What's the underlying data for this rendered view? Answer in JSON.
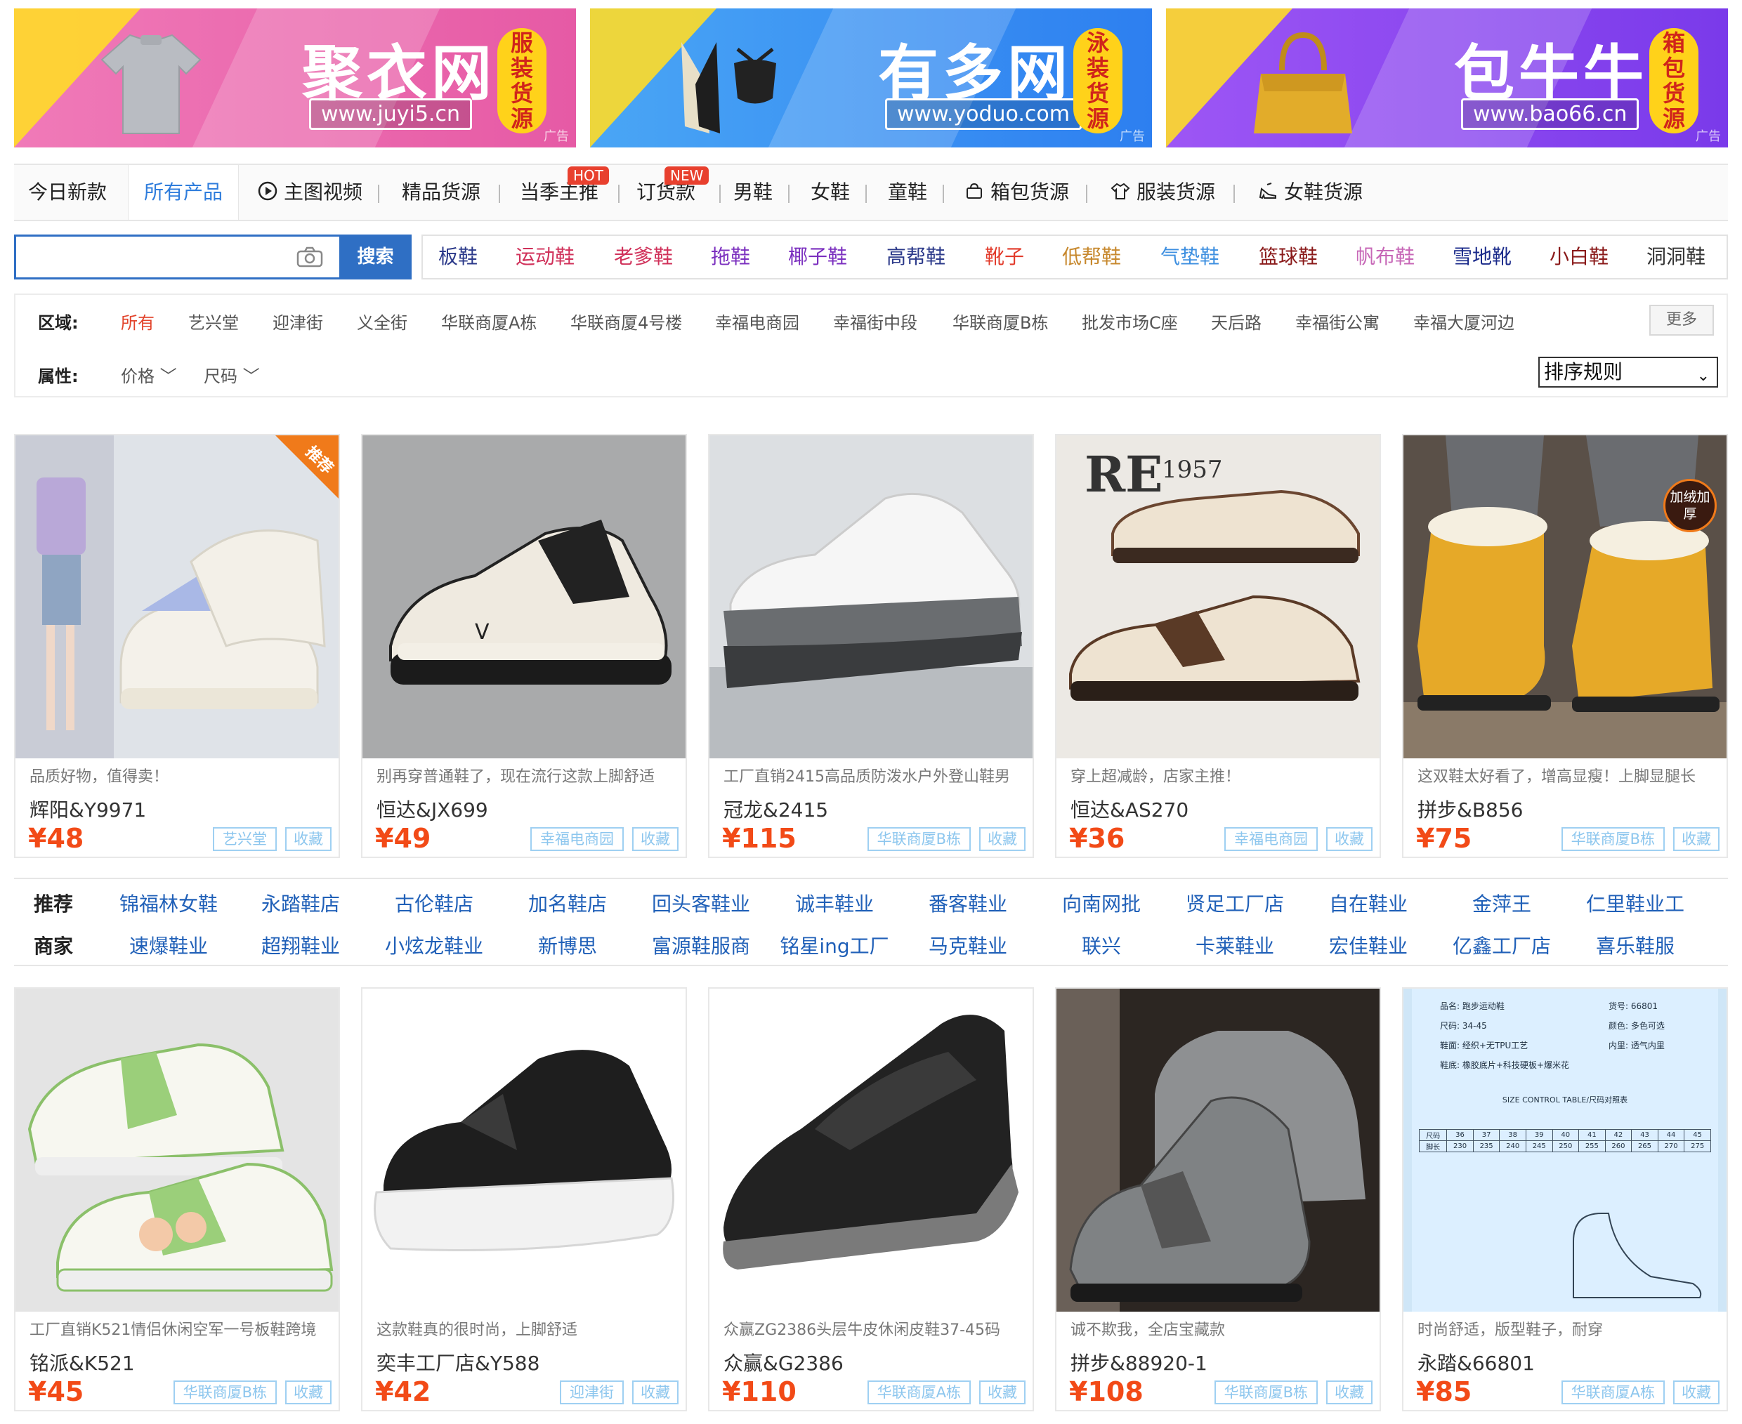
{
  "banners": [
    {
      "name": "聚衣网",
      "url": "www.juyi5.cn",
      "tag": [
        "服",
        "装",
        "货",
        "源"
      ],
      "ad": "广告",
      "color": "#ea5fa8"
    },
    {
      "name": "有多网",
      "url": "www.yoduo.com",
      "tag": [
        "泳",
        "装",
        "货",
        "源"
      ],
      "ad": "广告",
      "color": "#2f8ff0"
    },
    {
      "name": "包牛牛",
      "url": "www.bao66.cn",
      "tag": [
        "箱",
        "包",
        "货",
        "源"
      ],
      "ad": "广告",
      "color": "#8d4af0"
    }
  ],
  "nav": {
    "items": [
      "今日新款",
      "所有产品",
      "主图视频",
      "精品货源",
      "当季主推",
      "订货款",
      "男鞋",
      "女鞋",
      "童鞋",
      "箱包货源",
      "服装货源",
      "女鞋货源"
    ],
    "badges": {
      "hot": "HOT",
      "new": "NEW"
    }
  },
  "search": {
    "placeholder": "",
    "button": "搜索"
  },
  "categories": [
    {
      "label": "板鞋",
      "color": "#2c3a8a"
    },
    {
      "label": "运动鞋",
      "color": "#d0315a"
    },
    {
      "label": "老爹鞋",
      "color": "#d0315a"
    },
    {
      "label": "拖鞋",
      "color": "#7b2fbf"
    },
    {
      "label": "椰子鞋",
      "color": "#7b2fbf"
    },
    {
      "label": "高帮鞋",
      "color": "#2c3a8a"
    },
    {
      "label": "靴子",
      "color": "#e23a2a"
    },
    {
      "label": "低帮鞋",
      "color": "#c7882d"
    },
    {
      "label": "气垫鞋",
      "color": "#3d8fe0"
    },
    {
      "label": "篮球鞋",
      "color": "#8a1a1a"
    },
    {
      "label": "帆布鞋",
      "color": "#c767b7"
    },
    {
      "label": "雪地靴",
      "color": "#1a2a8a"
    },
    {
      "label": "小白鞋",
      "color": "#8a1a1a"
    },
    {
      "label": "洞洞鞋",
      "color": "#333333"
    }
  ],
  "filters": {
    "region_label": "区域:",
    "regions": [
      "所有",
      "艺兴堂",
      "迎津街",
      "义全街",
      "华联商厦A栋",
      "华联商厦4号楼",
      "幸福电商园",
      "幸福街中段",
      "华联商厦B栋",
      "批发市场C座",
      "天后路",
      "幸福街公寓",
      "幸福大厦河边"
    ],
    "more": "更多",
    "attr_label": "属性:",
    "attrs": [
      "价格",
      "尺码"
    ],
    "sort": "排序规则"
  },
  "products_row1": [
    {
      "desc": "品质好物，值得卖！",
      "title": "辉阳&Y9971",
      "price": "¥48",
      "location": "艺兴堂",
      "fav": "收藏",
      "badge": "推荐"
    },
    {
      "desc": "别再穿普通鞋了，现在流行这款上脚舒适",
      "title": "恒达&JX699",
      "price": "¥49",
      "location": "幸福电商园",
      "fav": "收藏"
    },
    {
      "desc": "工厂直销2415高品质防泼水户外登山鞋男",
      "title": "冠龙&2415",
      "price": "¥115",
      "location": "华联商厦B栋",
      "fav": "收藏"
    },
    {
      "desc": "穿上超减龄，店家主推！",
      "title": "恒达&AS270",
      "price": "¥36",
      "location": "幸福电商园",
      "fav": "收藏"
    },
    {
      "desc": "这双鞋太好看了，增高显瘦！上脚显腿长",
      "title": "拼步&B856",
      "price": "¥75",
      "location": "华联商厦B栋",
      "fav": "收藏",
      "badge": "加绒加厚"
    }
  ],
  "merchants": {
    "label1": "推荐",
    "label2": "商家",
    "row1": [
      "锦福林女鞋",
      "永踏鞋店",
      "古伦鞋店",
      "加名鞋店",
      "回头客鞋业",
      "诚丰鞋业",
      "番客鞋业",
      "向南网批",
      "贤足工厂店",
      "自在鞋业",
      "金萍王",
      "仁里鞋业工"
    ],
    "row2": [
      "速爆鞋业",
      "超翔鞋业",
      "小炫龙鞋业",
      "新博思",
      "富源鞋服商",
      "铭星ing工厂",
      "马克鞋业",
      "联兴",
      "卡莱鞋业",
      "宏佳鞋业",
      "亿鑫工厂店",
      "喜乐鞋服"
    ]
  },
  "products_row2": [
    {
      "desc": "工厂直销K521情侣休闲空军一号板鞋跨境",
      "title": "铭派&K521",
      "price": "¥45",
      "location": "华联商厦B栋",
      "fav": "收藏"
    },
    {
      "desc": "这款鞋真的很时尚，上脚舒适",
      "title": "奕丰工厂店&Y588",
      "price": "¥42",
      "location": "迎津街",
      "fav": "收藏"
    },
    {
      "desc": "众赢ZG2386头层牛皮休闲皮鞋37-45码",
      "title": "众赢&G2386",
      "price": "¥110",
      "location": "华联商厦A栋",
      "fav": "收藏"
    },
    {
      "desc": "诚不欺我，全店宝藏款",
      "title": "拼步&88920-1",
      "price": "¥108",
      "location": "华联商厦B栋",
      "fav": "收藏"
    },
    {
      "desc": "时尚舒适，版型鞋子，耐穿",
      "title": "永踏&66801",
      "price": "¥85",
      "location": "华联商厦A栋",
      "fav": "收藏"
    }
  ],
  "size_chart": {
    "rows": [
      "品名: 跑步运动鞋",
      "货号: 66801",
      "尺码: 34-45",
      "颜色: 多色可选",
      "鞋面: 经织+无TPU工艺",
      "内里: 透气内里",
      "鞋底: 橡胶底片+科技硬板+爆米花"
    ],
    "heading": "SIZE CONTROL TABLE/尺码对照表",
    "sizes": [
      "36",
      "37",
      "38",
      "39",
      "40",
      "41",
      "42",
      "43",
      "44",
      "45"
    ],
    "lengths": [
      "230",
      "235",
      "240",
      "245",
      "250",
      "255",
      "260",
      "265",
      "270",
      "275"
    ],
    "row_head1": "尺码",
    "row_head2": "脚长"
  }
}
